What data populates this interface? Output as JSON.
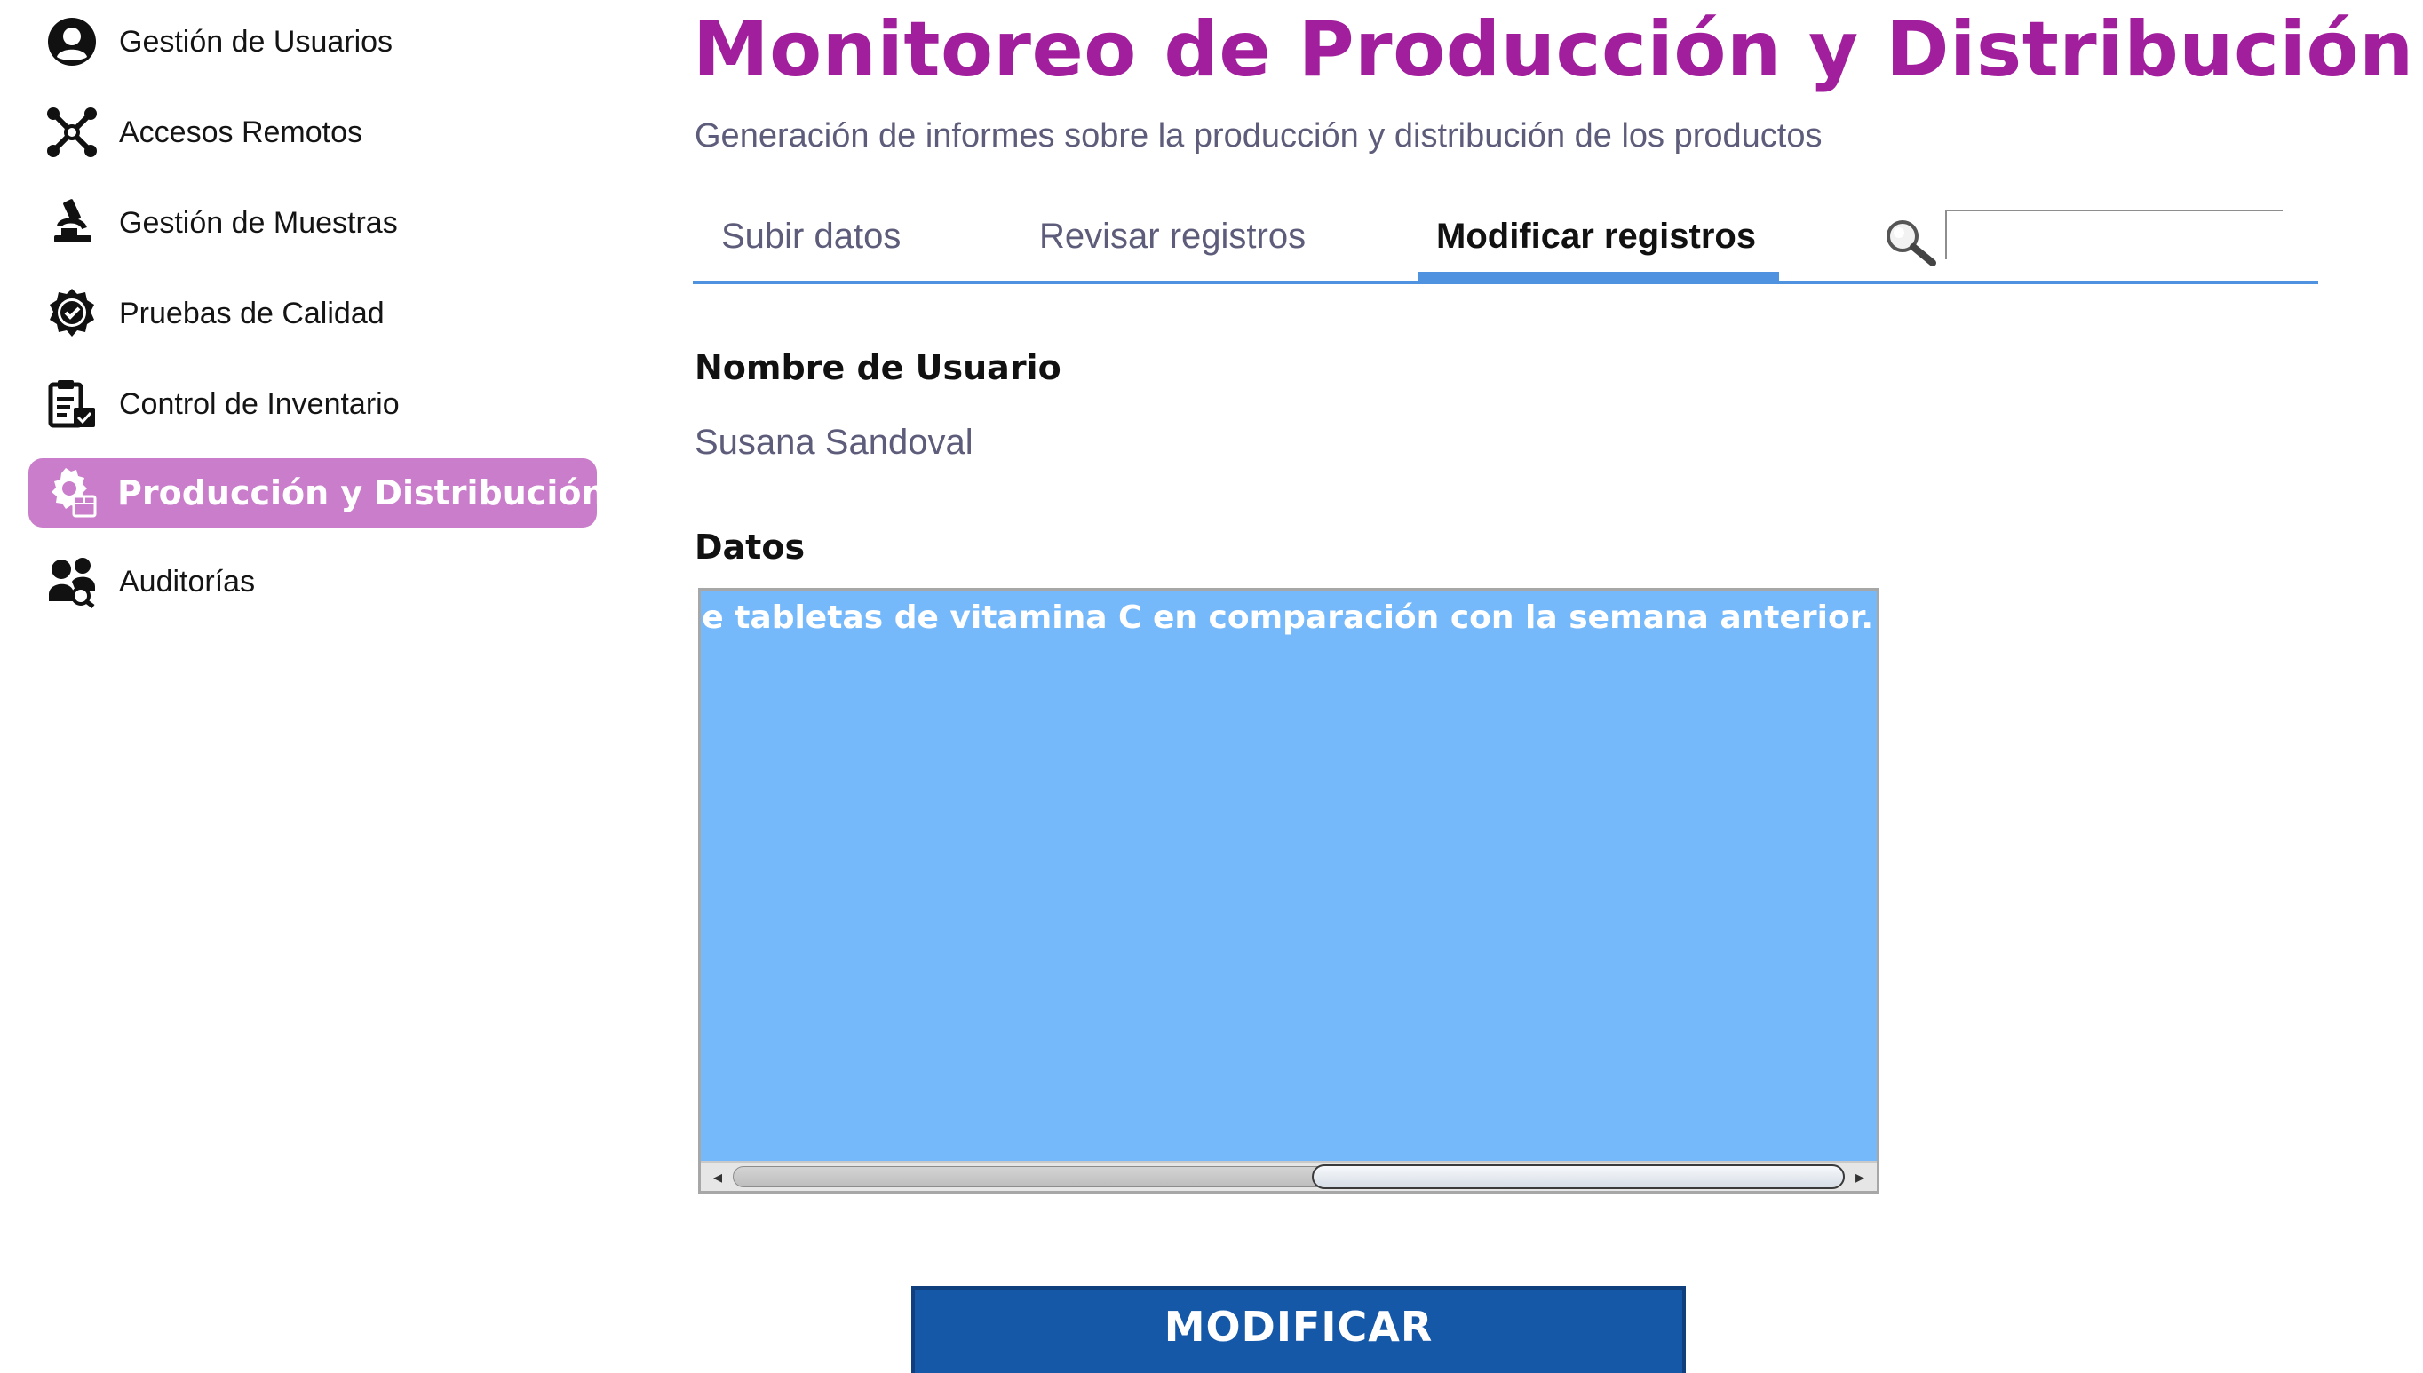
{
  "sidebar": {
    "items": [
      {
        "label": "Gestión de Usuarios",
        "icon": "user-circle-icon"
      },
      {
        "label": "Accesos Remotos",
        "icon": "remote-network-icon"
      },
      {
        "label": "Gestión de Muestras",
        "icon": "microscope-icon"
      },
      {
        "label": "Pruebas de Calidad",
        "icon": "quality-badge-icon"
      },
      {
        "label": "Control de Inventario",
        "icon": "clipboard-inventory-icon"
      },
      {
        "label": "Producción y Distribución",
        "icon": "gear-box-icon",
        "active": true
      },
      {
        "label": "Auditorías",
        "icon": "audit-people-icon"
      }
    ],
    "active_color": "#c97dca"
  },
  "header": {
    "title": "Monitoreo de Producción y Distribución",
    "subtitle": "Generación de informes sobre la producción y distribución de los productos",
    "title_color": "#a11e9c"
  },
  "tabs": {
    "items": [
      {
        "label": "Subir datos"
      },
      {
        "label": "Revisar registros"
      },
      {
        "label": "Modificar registros",
        "active": true
      }
    ],
    "accent_color": "#4f93e0"
  },
  "search": {
    "value": "",
    "placeholder": ""
  },
  "form": {
    "user_label": "Nombre de Usuario",
    "user_value": "Susana Sandoval",
    "data_label": "Datos",
    "data_value": "ucción de tabletas de vitamina C en comparación con la semana anterior.",
    "data_bg_color": "#76b9fb"
  },
  "actions": {
    "modify_label": "MODIFICAR",
    "button_color": "#1558a8"
  }
}
